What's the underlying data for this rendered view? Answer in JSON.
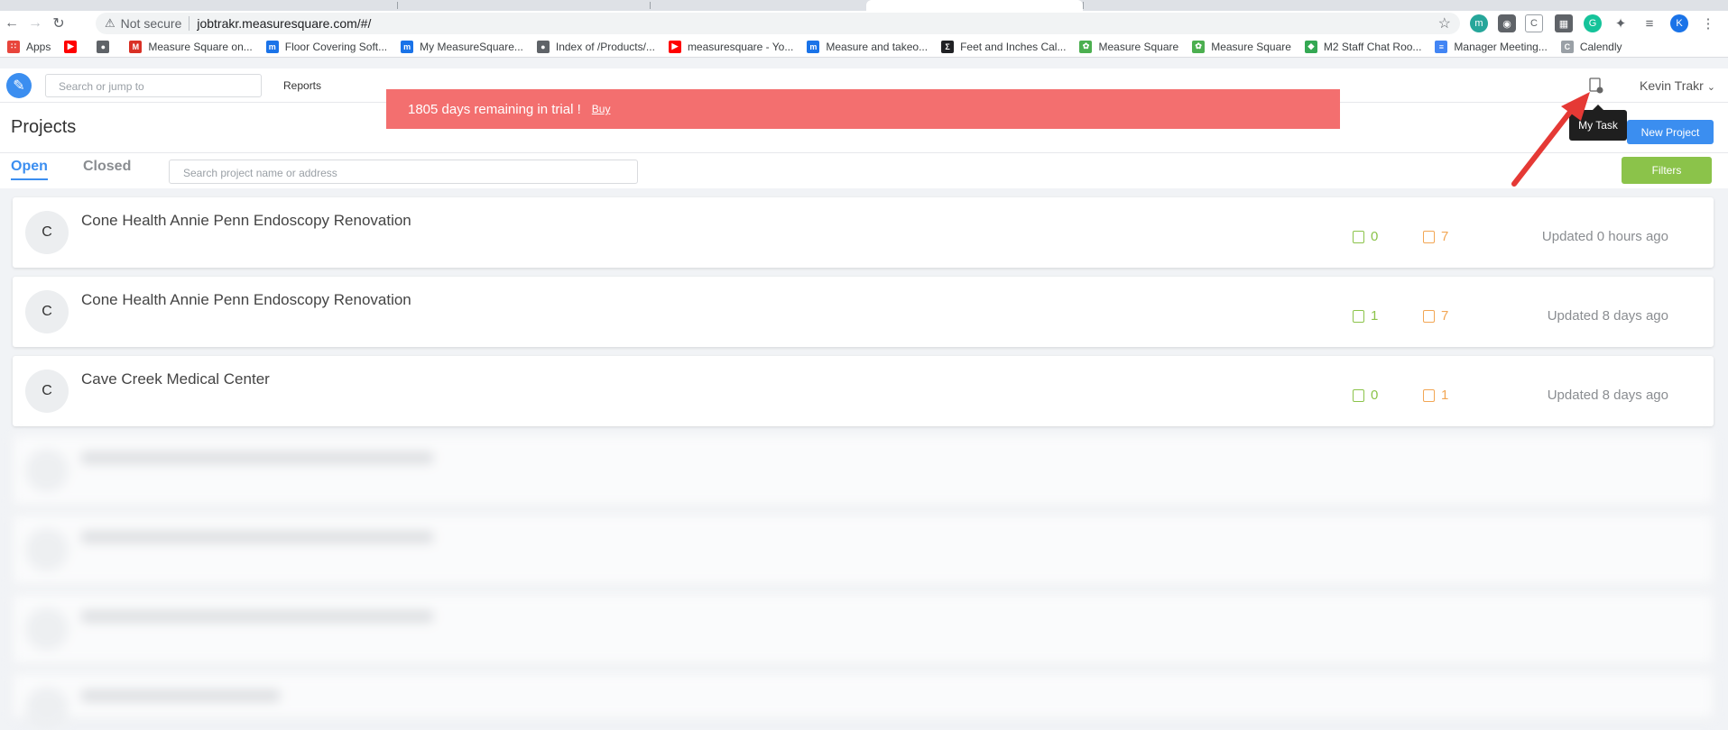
{
  "browser": {
    "url_warning": "Not secure",
    "url": "jobtrakr.measuresquare.com/#/",
    "bookmarks": [
      {
        "label": "Apps",
        "icon": "apps-grid-icon",
        "color": "#e8453c"
      },
      {
        "label": "",
        "icon": "youtube-icon",
        "color": "#ff0000"
      },
      {
        "label": "",
        "icon": "globe-icon",
        "color": "#5f6368"
      },
      {
        "label": "Measure Square on...",
        "icon": "gmail-icon",
        "color": "#d93025"
      },
      {
        "label": "Floor Covering Soft...",
        "icon": "measuresquare-icon",
        "color": "#1a73e8"
      },
      {
        "label": "My MeasureSquare...",
        "icon": "measuresquare-icon",
        "color": "#1a73e8"
      },
      {
        "label": "Index of /Products/...",
        "icon": "globe-icon",
        "color": "#5f6368"
      },
      {
        "label": "measuresquare - Yo...",
        "icon": "youtube-icon",
        "color": "#ff0000"
      },
      {
        "label": "Measure and takeo...",
        "icon": "measuresquare-icon",
        "color": "#1a73e8"
      },
      {
        "label": "Feet and Inches Cal...",
        "icon": "sigma-icon",
        "color": "#202124"
      },
      {
        "label": "Measure Square",
        "icon": "leaf-icon",
        "color": "#4caf50"
      },
      {
        "label": "Measure Square",
        "icon": "leaf-icon",
        "color": "#4caf50"
      },
      {
        "label": "M2 Staff Chat Roo...",
        "icon": "chat-icon",
        "color": "#34a853"
      },
      {
        "label": "Manager Meeting...",
        "icon": "docs-icon",
        "color": "#4285f4"
      },
      {
        "label": "Calendly",
        "icon": "calendly-icon",
        "color": "#9aa0a6"
      }
    ]
  },
  "header": {
    "jump_placeholder": "Search or jump to",
    "reports": "Reports",
    "user": "Kevin Trakr",
    "tooltip": "My Task"
  },
  "banner": {
    "text": "1805 days remaining in trial !",
    "buy": "Buy"
  },
  "projects": {
    "title": "Projects",
    "tab_open": "Open",
    "tab_closed": "Closed",
    "search_placeholder": "Search project name or address",
    "new_project": "New Project",
    "filters": "Filters",
    "items": [
      {
        "initial": "C",
        "name": "Cone Health Annie Penn Endoscopy Renovation",
        "tasks": "0",
        "notes": "7",
        "updated": "Updated 0 hours ago"
      },
      {
        "initial": "C",
        "name": "Cone Health Annie Penn Endoscopy Renovation",
        "tasks": "1",
        "notes": "7",
        "updated": "Updated 8 days ago"
      },
      {
        "initial": "C",
        "name": "Cave Creek Medical Center",
        "tasks": "0",
        "notes": "1",
        "updated": "Updated 8 days ago"
      }
    ]
  },
  "colors": {
    "accent": "#3b8ef0",
    "banner": "#f36f6f",
    "filters": "#8bc34a",
    "annotation_arrow": "#e53935"
  }
}
